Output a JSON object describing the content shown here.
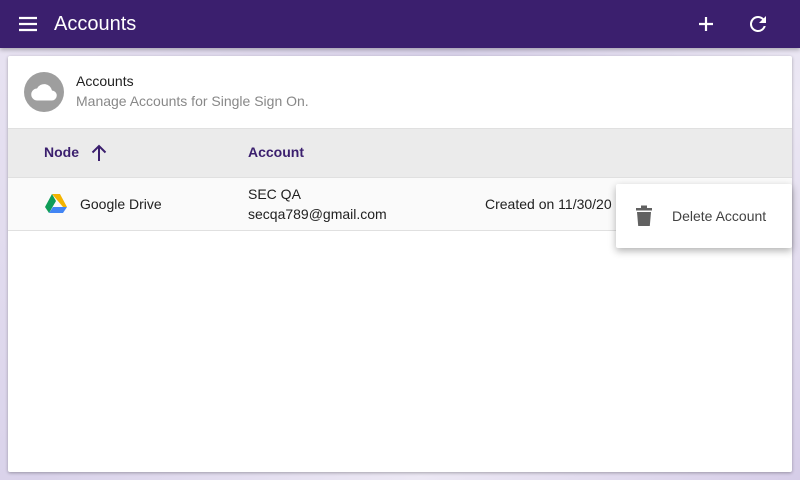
{
  "appbar": {
    "title": "Accounts",
    "menu_icon": "menu-icon",
    "add_icon": "plus-icon",
    "refresh_icon": "refresh-icon",
    "color": "#3b1f6e"
  },
  "card_header": {
    "title": "Accounts",
    "subtitle": "Manage Accounts for Single Sign On.",
    "avatar_icon": "cloud-icon"
  },
  "table": {
    "columns": [
      {
        "label": "Node",
        "sort": "ascending"
      },
      {
        "label": "Account"
      }
    ],
    "rows": [
      {
        "node_icon": "google-drive-icon",
        "node": "Google Drive",
        "account_name": "SEC QA",
        "account_email": "secqa789@gmail.com",
        "created": "Created on 11/30/20"
      }
    ]
  },
  "context_menu": {
    "items": [
      {
        "label": "Delete Account",
        "icon": "trash-icon"
      }
    ]
  }
}
